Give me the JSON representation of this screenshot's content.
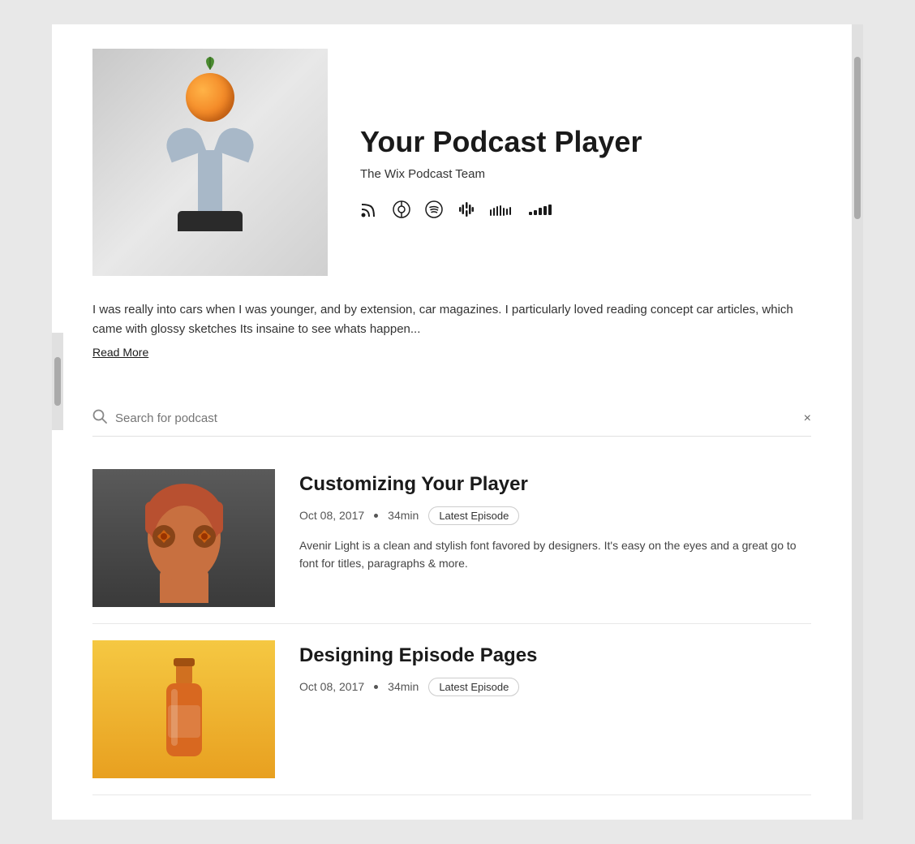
{
  "podcast": {
    "title": "Your Podcast Player",
    "author": "The Wix Podcast Team",
    "description": "I was really into cars when I was younger, and by extension, car magazines. I particularly loved reading concept car articles, which came with glossy sketches Its insaine to see whats happen...",
    "read_more_label": "Read More"
  },
  "icons": {
    "rss": "rss-icon",
    "apple": "apple-podcasts-icon",
    "spotify": "spotify-icon",
    "google": "google-podcasts-icon",
    "soundcloud": "soundcloud-icon",
    "deezer": "deezer-icon"
  },
  "search": {
    "placeholder": "Search for podcast",
    "clear_label": "×"
  },
  "episodes": [
    {
      "title": "Customizing Your Player",
      "date": "Oct 08, 2017",
      "duration": "34min",
      "badge": "Latest Episode",
      "description": "Avenir Light is a clean and stylish font favored by designers. It's easy on the eyes and a great go to font for titles, paragraphs & more."
    },
    {
      "title": "Designing Episode Pages",
      "date": "Oct 08, 2017",
      "duration": "34min",
      "badge": "Latest Episode",
      "description": ""
    }
  ]
}
